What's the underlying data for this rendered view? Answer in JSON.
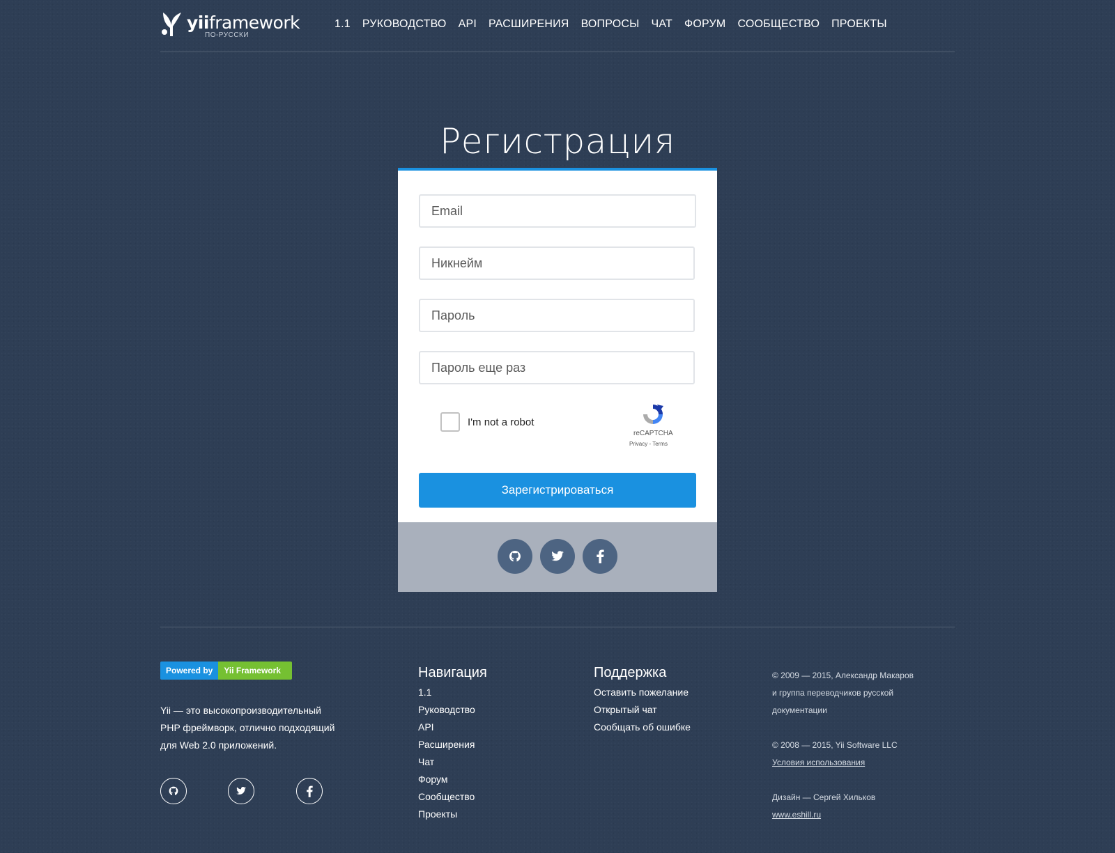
{
  "header": {
    "logo_text_bold": "yii",
    "logo_text": "framework",
    "logo_sub": "ПО-РУССКИ",
    "nav": [
      "1.1",
      "РУКОВОДСТВО",
      "API",
      "РАСШИРЕНИЯ",
      "ВОПРОСЫ",
      "ЧАТ",
      "ФОРУМ",
      "СООБЩЕСТВО",
      "ПРОЕКТЫ"
    ]
  },
  "page_title": "Регистрация",
  "form": {
    "email_placeholder": "Email",
    "nickname_placeholder": "Никнейм",
    "password_placeholder": "Пароль",
    "password_repeat_placeholder": "Пароль еще раз",
    "captcha_label": "I'm not a robot",
    "captcha_brand": "reCAPTCHA",
    "captcha_links": "Privacy - Terms",
    "submit_label": "Зарегистрироваться"
  },
  "social": [
    "github-icon",
    "twitter-icon",
    "facebook-icon"
  ],
  "footer": {
    "badge_left": "Powered by",
    "badge_right": "Yii Framework",
    "about_line1": "Yii — это высокопроизводительный",
    "about_line2": "PHP фреймворк, отлично подходящий",
    "about_line3": "для Web 2.0 приложений.",
    "nav_title": "Навигация",
    "nav_links": [
      "1.1",
      "Руководство",
      "API",
      "Расширения",
      "Чат",
      "Форум",
      "Сообщество",
      "Проекты"
    ],
    "support_title": "Поддержка",
    "support_links": [
      "Оставить пожелание",
      "Открытый чат",
      "Сообщать об ошибке"
    ],
    "copy1_line1": "© 2009 — 2015, Александр Макаров",
    "copy1_line2": "и группа переводчиков русской",
    "copy1_line3": "документации",
    "copy2": "© 2008 — 2015, Yii Software LLC",
    "terms_link": "Условия использования",
    "design": "Дизайн — Сергей Хильков",
    "design_link": "www.eshill.ru"
  },
  "colors": {
    "accent": "#1a91e0",
    "badge_green": "#75c032",
    "background": "#2e3e55"
  }
}
